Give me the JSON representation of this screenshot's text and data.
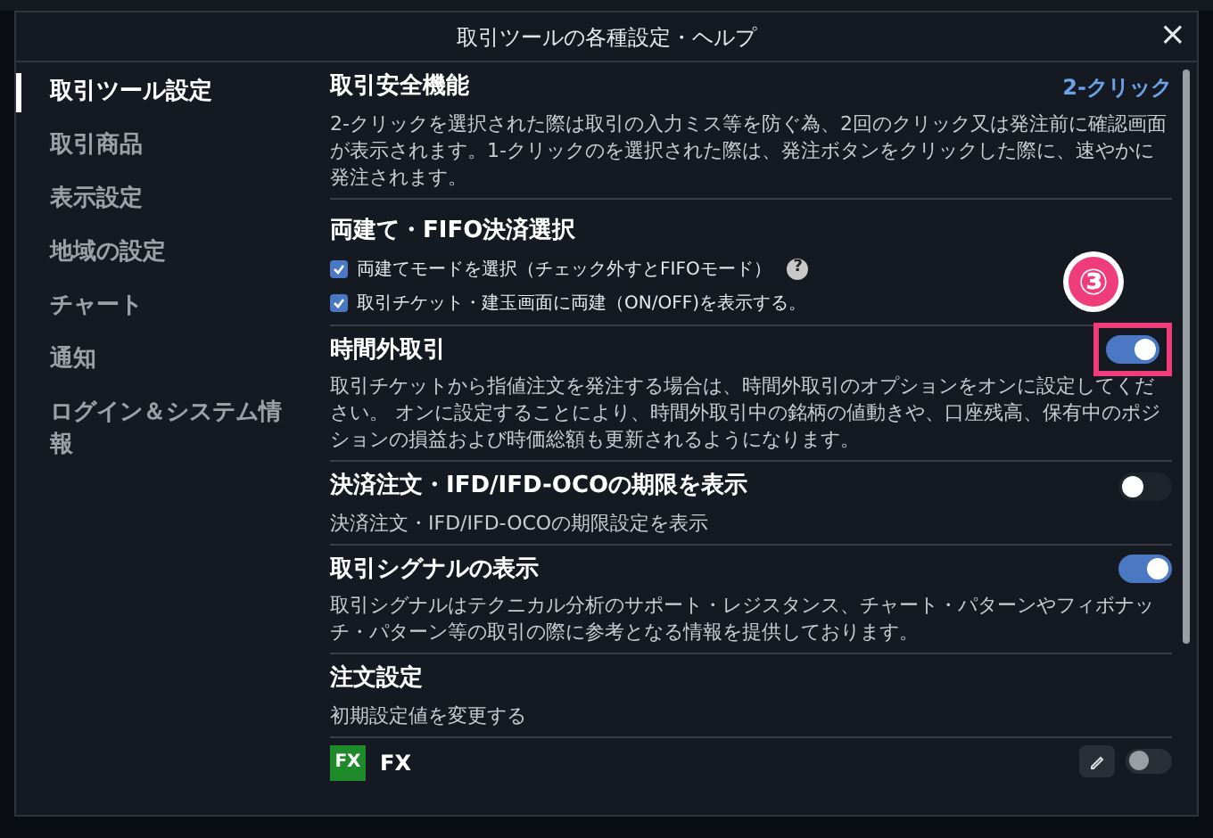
{
  "window": {
    "title": "取引ツールの各種設定・ヘルプ",
    "close": "×"
  },
  "sidebar": {
    "items": [
      {
        "label": "取引ツール設定",
        "selected": true
      },
      {
        "label": "取引商品",
        "selected": false
      },
      {
        "label": "表示設定",
        "selected": false
      },
      {
        "label": "地域の設定",
        "selected": false
      },
      {
        "label": "チャート",
        "selected": false
      },
      {
        "label": "通知",
        "selected": false
      },
      {
        "label": "ログイン＆システム情報",
        "selected": false
      }
    ]
  },
  "sections": [
    {
      "kind": "info",
      "title": "取引安全機能",
      "value": "2-クリック",
      "description": "2-クリックを選択された際は取引の入力ミス等を防ぐ為、2回のクリック又は発注前に確認画面が表示されます。1-クリックのを選択された際は、発注ボタンをクリックした際に、速やかに発注されます。"
    },
    {
      "kind": "checks",
      "title": "両建て・FIFO決済選択",
      "options": [
        {
          "label": "両建てモードを選択（チェック外すとFIFOモード）",
          "checked": true,
          "help": "?"
        },
        {
          "label": "取引チケット・建玉画面に両建（ON/OFF)を表示する。",
          "checked": true
        }
      ]
    },
    {
      "kind": "toggle",
      "title": "時間外取引",
      "on": true,
      "highlighted": true,
      "description": "取引チケットから指値注文を発注する場合は、時間外取引のオプションをオンに設定してください。 オンに設定することにより、時間外取引中の銘柄の値動きや、口座残高、保有中のポジションの損益および時価総額も更新されるようになります。"
    },
    {
      "kind": "toggle",
      "title": "決済注文・IFD/IFD-OCOの期限を表示",
      "on": false,
      "highlighted": false,
      "description": "決済注文・IFD/IFD-OCOの期限設定を表示"
    },
    {
      "kind": "toggle",
      "title": "取引シグナルの表示",
      "on": true,
      "highlighted": false,
      "description": "取引シグナルはテクニカル分析のサポート・レジスタンス、チャート・パターンやフィボナッチ・パターン等の取引の際に参考となる情報を提供しております。"
    },
    {
      "kind": "info",
      "title": "注文設定",
      "description": "初期設定値を変更する"
    },
    {
      "kind": "product",
      "badge": "FX",
      "label": "FX",
      "on": false
    }
  ],
  "annotation": {
    "label": "③"
  }
}
